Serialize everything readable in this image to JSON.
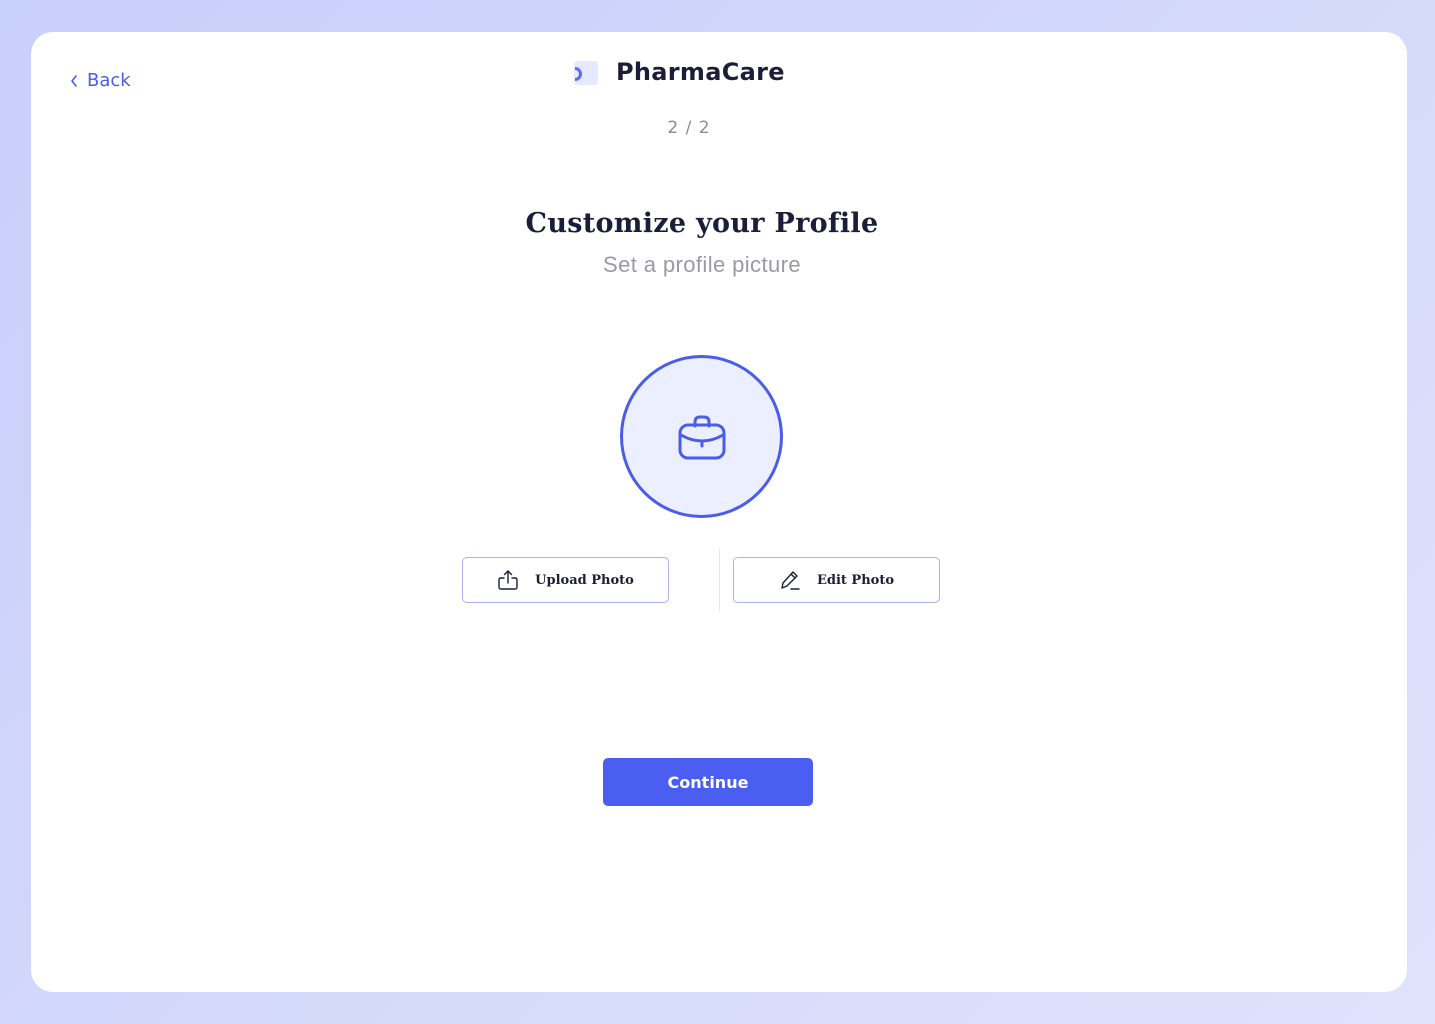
{
  "nav": {
    "back_label": "Back"
  },
  "brand": {
    "name": "PharmaCare"
  },
  "progress": {
    "step_text": "2 / 2"
  },
  "heading": {
    "title": "Customize your Profile",
    "subtitle": "Set a profile picture"
  },
  "avatar": {
    "icon": "briefcase-icon"
  },
  "actions": {
    "upload_label": "Upload Photo",
    "upload_icon": "upload-icon",
    "edit_label": "Edit Photo",
    "edit_icon": "pencil-icon"
  },
  "footer": {
    "continue_label": "Continue"
  },
  "colors": {
    "accent": "#4a5ef1",
    "background": "#cfd5fb",
    "title": "#1d1d3a",
    "muted": "#9a9aa6"
  }
}
